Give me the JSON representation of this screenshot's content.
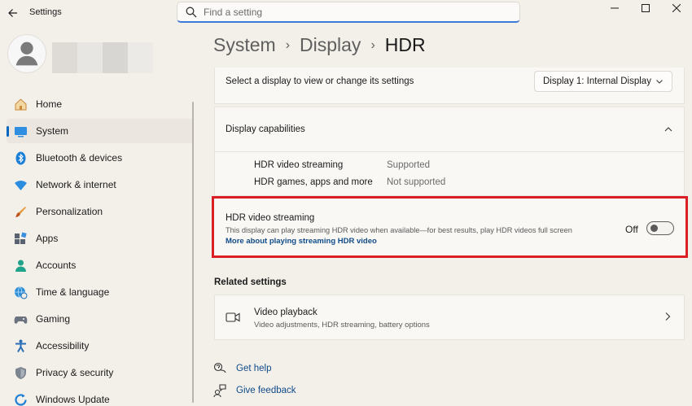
{
  "window": {
    "title": "Settings",
    "controls": [
      "minimize",
      "maximize",
      "close"
    ]
  },
  "search": {
    "placeholder": "Find a setting"
  },
  "breadcrumb": [
    {
      "label": "System"
    },
    {
      "label": "Display"
    },
    {
      "label": "HDR"
    }
  ],
  "sidebar": {
    "items": [
      {
        "label": "Home",
        "icon": "home-icon"
      },
      {
        "label": "System",
        "icon": "system-icon",
        "active": true
      },
      {
        "label": "Bluetooth & devices",
        "icon": "bluetooth-icon"
      },
      {
        "label": "Network & internet",
        "icon": "wifi-icon"
      },
      {
        "label": "Personalization",
        "icon": "brush-icon"
      },
      {
        "label": "Apps",
        "icon": "apps-icon"
      },
      {
        "label": "Accounts",
        "icon": "accounts-icon"
      },
      {
        "label": "Time & language",
        "icon": "globe-clock-icon"
      },
      {
        "label": "Gaming",
        "icon": "gamepad-icon"
      },
      {
        "label": "Accessibility",
        "icon": "accessibility-icon"
      },
      {
        "label": "Privacy & security",
        "icon": "shield-icon"
      },
      {
        "label": "Windows Update",
        "icon": "update-icon"
      }
    ]
  },
  "display_select": {
    "label": "Select a display to view or change its settings",
    "selected": "Display 1: Internal Display"
  },
  "capabilities": {
    "title": "Display capabilities",
    "rows": [
      {
        "name": "HDR video streaming",
        "value": "Supported"
      },
      {
        "name": "HDR games, apps and more",
        "value": "Not supported"
      }
    ]
  },
  "hdr_streaming": {
    "title": "HDR video streaming",
    "description": "This display can play streaming HDR video when available—for best results, play HDR videos full screen",
    "link": "More about playing streaming HDR video",
    "toggle_label": "Off",
    "toggle_on": false
  },
  "related": {
    "heading": "Related settings",
    "video_playback": {
      "title": "Video playback",
      "subtitle": "Video adjustments, HDR streaming, battery options"
    }
  },
  "help": {
    "get_help": "Get help",
    "give_feedback": "Give feedback"
  },
  "colors": {
    "accent": "#0067c0",
    "highlight_border": "#d91e26",
    "link": "#0f4c8a",
    "background": "#f3efe9"
  }
}
